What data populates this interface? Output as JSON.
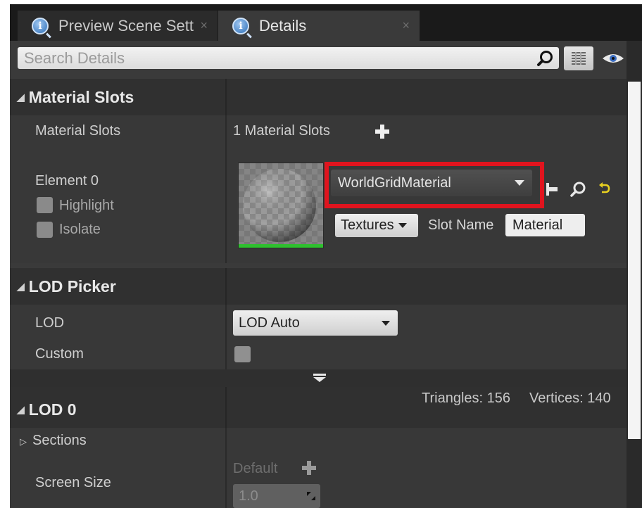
{
  "tabs": [
    {
      "label": "Preview Scene Sett",
      "close": "×"
    },
    {
      "label": "Details",
      "close": "×"
    }
  ],
  "search": {
    "placeholder": "Search Details",
    "icon": "search-icon"
  },
  "sections": {
    "material_slots": {
      "header": "Material Slots",
      "slots_label": "Material Slots",
      "slots_count": "1 Material Slots",
      "element_label": "Element 0",
      "highlight_label": "Highlight",
      "isolate_label": "Isolate",
      "material_value": "WorldGridMaterial",
      "textures_label": "Textures",
      "slot_name_label": "Slot Name",
      "slot_name_value": "Material"
    },
    "lod_picker": {
      "header": "LOD Picker",
      "lod_label": "LOD",
      "lod_value": "LOD Auto",
      "custom_label": "Custom"
    },
    "lod0": {
      "header": "LOD 0",
      "triangles": "Triangles: 156",
      "vertices": "Vertices: 140",
      "sections_label": "Sections",
      "screen_size_label": "Screen Size",
      "default_label": "Default",
      "screen_size_value": "1.0"
    }
  },
  "colors": {
    "highlight_box": "#e0141e",
    "thumbnail_bar": "#2ec02e",
    "reset_arrow": "#e8d020"
  }
}
